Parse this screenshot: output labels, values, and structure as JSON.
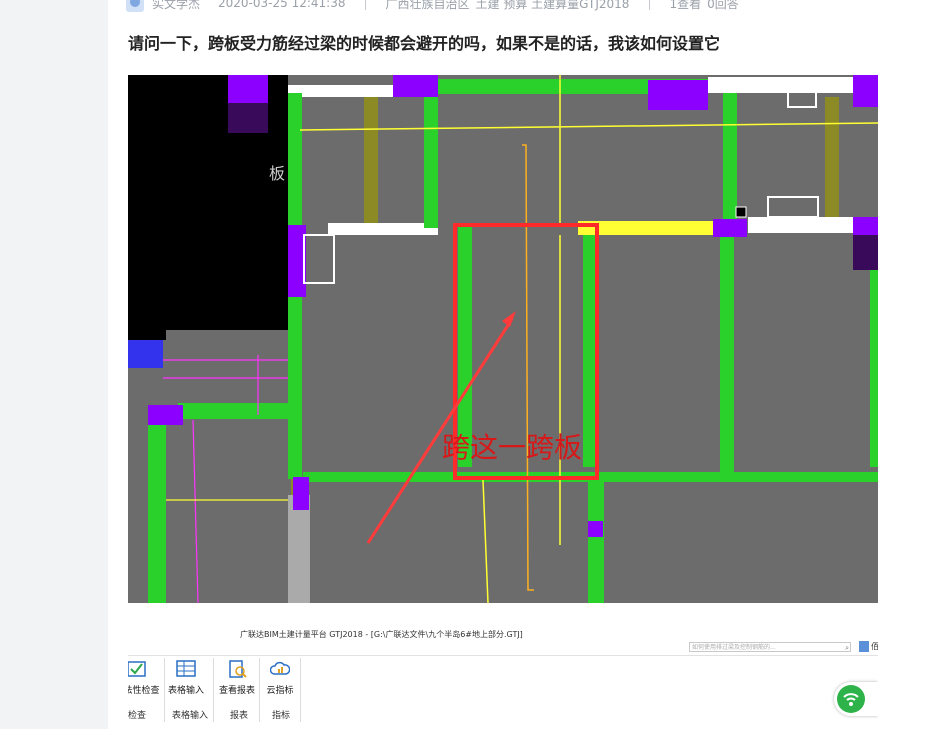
{
  "post": {
    "author": "实文学杰",
    "datetime": "2020-03-25 12:41:38",
    "region": "广西壮族自治区",
    "tags": "土建 预算 土建算量GTJ2018",
    "views": "1查看",
    "answers": "0回答",
    "question": "请问一下，跨板受力筋经过梁的时候都会避开的吗，如果不是的话，我该如何设置它"
  },
  "screenshot": {
    "board_label": "板",
    "annotation": "跨这一跨板",
    "app_title": "广联达BIM土建计量平台 GTJ2018 - [G:\\广联达文件\\九个半岛6#地上部分.GTJ]",
    "search_placeholder": "如何使用排过梁及控制钢筋的...",
    "user_label": "佰",
    "ribbon": {
      "buttons": [
        {
          "label": "合法性检查",
          "icon": "check-icon"
        },
        {
          "label": "表格输入",
          "icon": "table-icon"
        },
        {
          "label": "查看报表",
          "icon": "report-icon"
        },
        {
          "label": "云指标",
          "icon": "cloud-icon"
        }
      ],
      "groups": [
        "检查",
        "表格输入",
        "报表",
        "指标"
      ]
    },
    "colors": {
      "beam": "#2bd12b",
      "wall": "#8b00ff",
      "slab": "#6c6c6c",
      "rebar": "#ffff33",
      "highlight": "#ff2a2a",
      "annotation_text": "#d81818"
    }
  }
}
